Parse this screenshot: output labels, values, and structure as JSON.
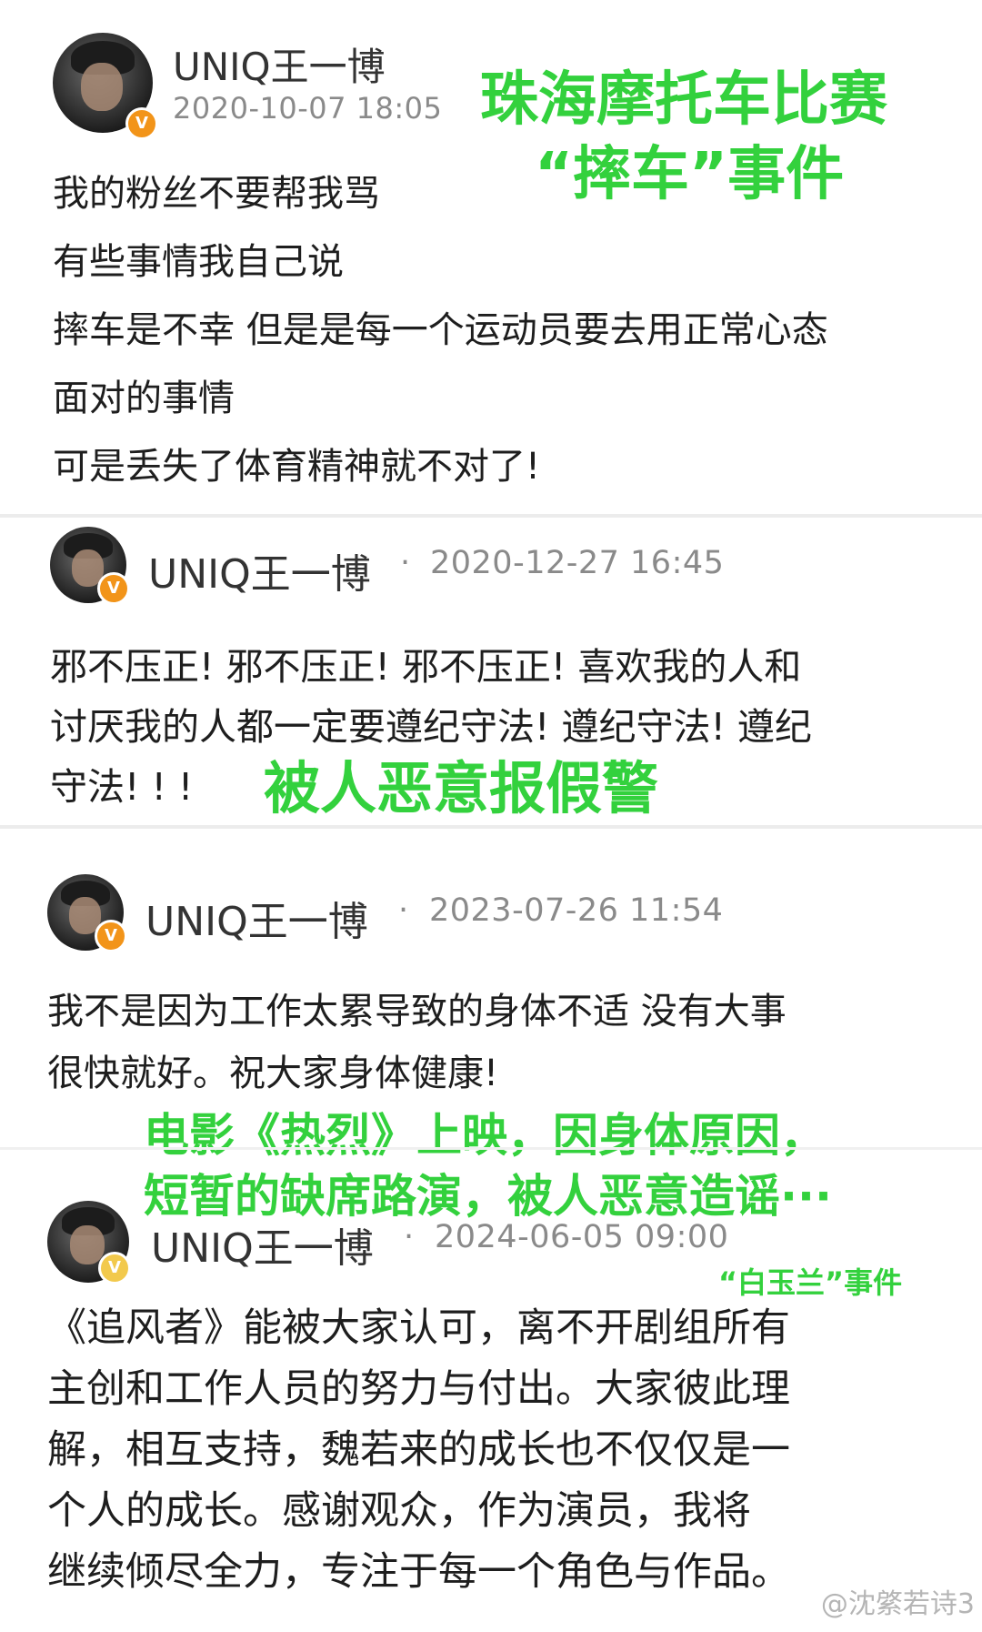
{
  "posts": [
    {
      "username": "UNIQ王一博",
      "timestamp": "2020-10-07 18:05",
      "lines": [
        "我的粉丝不要帮我骂",
        "有些事情我自己说",
        "摔车是不幸 但是是每一个运动员要去用正常心态",
        "面对的事情",
        "可是丢失了体育精神就不对了!"
      ]
    },
    {
      "username": "UNIQ王一博",
      "separator": "·",
      "timestamp": "2020-12-27 16:45",
      "lines": [
        "邪不压正! 邪不压正! 邪不压正!  喜欢我的人和",
        "讨厌我的人都一定要遵纪守法! 遵纪守法! 遵纪",
        "守法! ! !"
      ]
    },
    {
      "username": "UNIQ王一博",
      "separator": "·",
      "timestamp": "2023-07-26 11:54",
      "lines": [
        "我不是因为工作太累导致的身体不适 没有大事",
        "很快就好。祝大家身体健康!"
      ]
    },
    {
      "username": "UNIQ王一博",
      "separator": "·",
      "timestamp": "2024-06-05 09:00",
      "lines": [
        "《追风者》能被大家认可，离不开剧组所有",
        "主创和工作人员的努力与付出。大家彼此理",
        "解，相互支持，魏若来的成长也不仅仅是一",
        "个人的成长。感谢观众，作为演员，我将",
        "继续倾尽全力，专注于每一个角色与作品。"
      ]
    }
  ],
  "overlays": {
    "zhuhai_line1": "珠海摩托车比赛",
    "zhuhai_line2": "“摔车”事件",
    "false_report": "被人恶意报假警",
    "movie_line1": "电影《热烈》上映，因身体原因，",
    "movie_line2": "短暂的缺席路演，被人恶意造谣···",
    "baiyulan": "“白玉兰”事件"
  },
  "badge_letter": "V",
  "watermark": "@沈綮若诗3",
  "colors": {
    "overlay_green": "#33d13d",
    "verified_orange": "#f29419",
    "verified_gold": "#f2c94c"
  }
}
